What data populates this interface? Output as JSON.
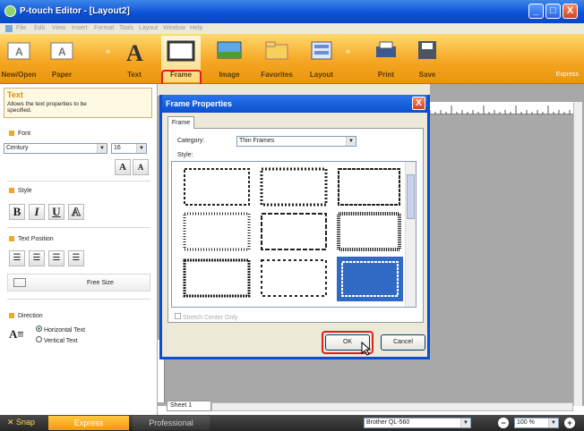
{
  "window": {
    "title": "P-touch Editor - [Layout2]",
    "min": "_",
    "max": "□",
    "close": "X"
  },
  "menu": [
    "File",
    "Edit",
    "View",
    "Insert",
    "Format",
    "Tools",
    "Layout",
    "Window",
    "Help"
  ],
  "ribbon": {
    "items": [
      {
        "label": "New/Open"
      },
      {
        "label": "Paper"
      },
      {
        "label": "Text"
      },
      {
        "label": "Frame"
      },
      {
        "label": "Image"
      },
      {
        "label": "Favorites"
      },
      {
        "label": "Layout"
      },
      {
        "label": "Print"
      },
      {
        "label": "Save"
      }
    ],
    "express": "Express",
    "arrow": "»"
  },
  "panel": {
    "heading": "Text",
    "hint": "Allows the text properties to be specified.",
    "font_section": "Font",
    "font_name": "Century",
    "font_size": "16",
    "grow": "A",
    "shrink": "A",
    "style_section": "Style",
    "bold": "B",
    "italic": "I",
    "underline": "U",
    "outline": "A",
    "position_section": "Text Position",
    "free_size": "Free Size",
    "direction_section": "Direction",
    "horizontal": "Horizontal Text",
    "vertical": "Vertical Text"
  },
  "dialog": {
    "title": "Frame Properties",
    "tab": "Frame",
    "category_label": "Category:",
    "category_value": "Thin Frames",
    "style_label": "Style:",
    "checkbox": "Stretch Center Only",
    "ok": "OK",
    "cancel": "Cancel",
    "close": "X"
  },
  "canvas": {
    "sheet": "Sheet 1"
  },
  "statusbar": {
    "snap": "Snap",
    "tab_express": "Express",
    "tab_professional": "Professional",
    "printer": "Brother QL-560",
    "zoom": "100 %"
  }
}
